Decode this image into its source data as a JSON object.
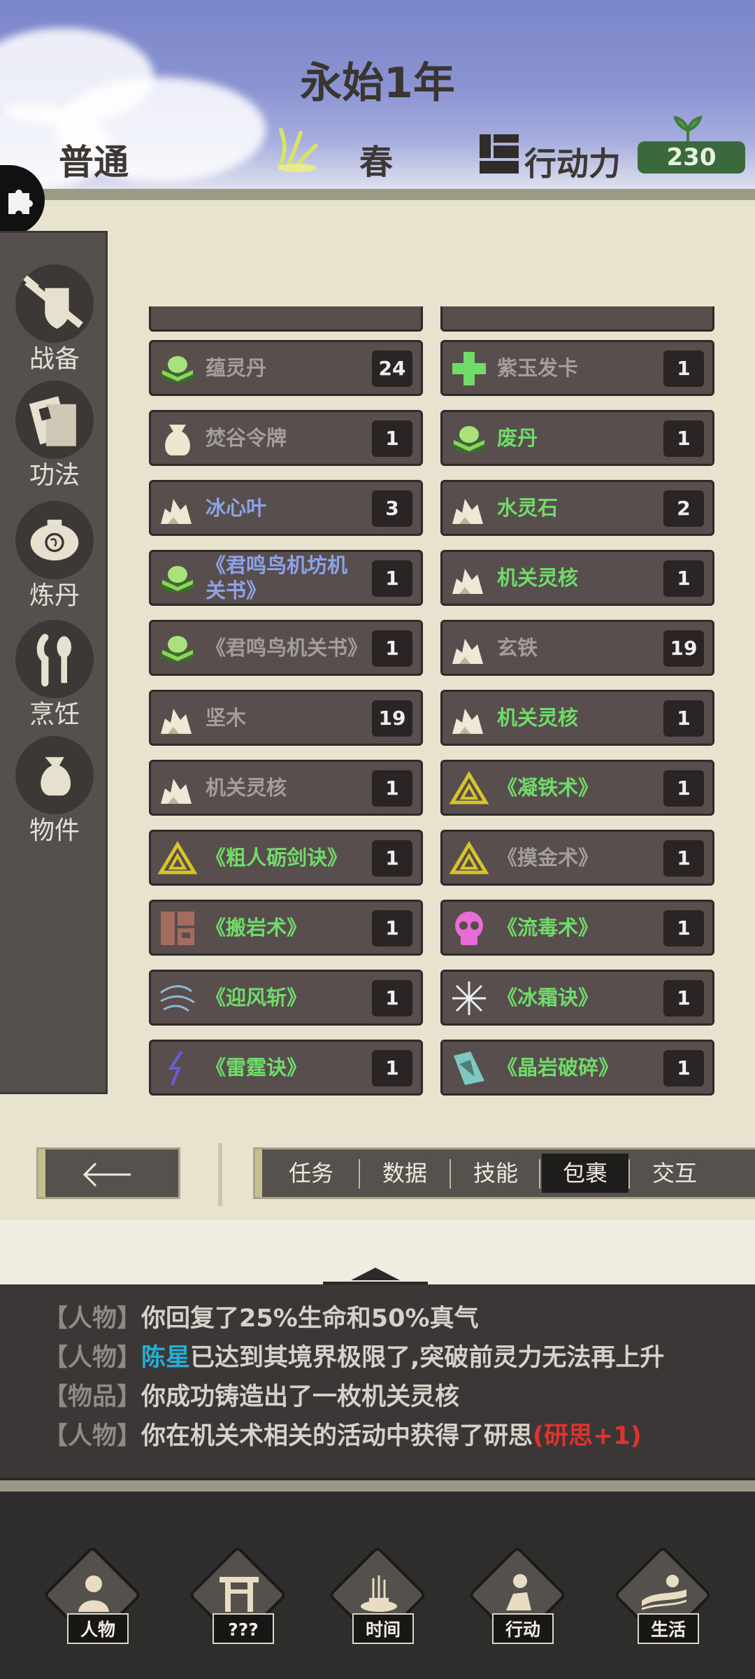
{
  "header": {
    "title": "永始1年",
    "difficulty": "普通",
    "season": "春",
    "action_label": "行动力",
    "action_value": "230"
  },
  "sidebar": {
    "items": [
      {
        "label": "战备",
        "icon": "sword-shield-icon"
      },
      {
        "label": "功法",
        "icon": "book-icon"
      },
      {
        "label": "炼丹",
        "icon": "cauldron-icon"
      },
      {
        "label": "烹饪",
        "icon": "fork-spoon-icon"
      },
      {
        "label": "物件",
        "icon": "bag-icon"
      }
    ]
  },
  "inventory": {
    "left": [
      {
        "name": "蕴灵丹",
        "count": "24",
        "color": "gray",
        "icon": "pill-icon"
      },
      {
        "name": "焚谷令牌",
        "count": "1",
        "color": "gray",
        "icon": "pouch-icon"
      },
      {
        "name": "冰心叶",
        "count": "3",
        "color": "blue",
        "icon": "ore-icon"
      },
      {
        "name": "《君鸣鸟机坊机关书》",
        "count": "1",
        "color": "blue",
        "icon": "pill-icon"
      },
      {
        "name": "《君鸣鸟机关书》",
        "count": "1",
        "color": "gray",
        "icon": "pill-icon"
      },
      {
        "name": "坚木",
        "count": "19",
        "color": "gray",
        "icon": "ore-icon"
      },
      {
        "name": "机关灵核",
        "count": "1",
        "color": "gray",
        "icon": "ore-icon"
      },
      {
        "name": "《粗人砺剑诀》",
        "count": "1",
        "color": "green",
        "icon": "triangle-icon"
      },
      {
        "name": "《搬岩术》",
        "count": "1",
        "color": "green",
        "icon": "block-icon"
      },
      {
        "name": "《迎风斩》",
        "count": "1",
        "color": "green",
        "icon": "wind-icon"
      },
      {
        "name": "《雷霆诀》",
        "count": "1",
        "color": "green",
        "icon": "lightning-icon"
      }
    ],
    "right": [
      {
        "name": "紫玉发卡",
        "count": "1",
        "color": "gray",
        "icon": "cross-icon"
      },
      {
        "name": "废丹",
        "count": "1",
        "color": "green",
        "icon": "pill-icon"
      },
      {
        "name": "水灵石",
        "count": "2",
        "color": "green",
        "icon": "ore-icon"
      },
      {
        "name": "机关灵核",
        "count": "1",
        "color": "green",
        "icon": "ore-icon"
      },
      {
        "name": "玄铁",
        "count": "19",
        "color": "gray",
        "icon": "ore-icon"
      },
      {
        "name": "机关灵核",
        "count": "1",
        "color": "green",
        "icon": "ore-icon"
      },
      {
        "name": "《凝铁术》",
        "count": "1",
        "color": "green",
        "icon": "triangle-icon"
      },
      {
        "name": "《摸金术》",
        "count": "1",
        "color": "gray",
        "icon": "triangle-icon"
      },
      {
        "name": "《流毒术》",
        "count": "1",
        "color": "green",
        "icon": "skull-icon"
      },
      {
        "name": "《冰霜诀》",
        "count": "1",
        "color": "green",
        "icon": "frost-icon"
      },
      {
        "name": "《晶岩破碎》",
        "count": "1",
        "color": "green",
        "icon": "crystal-icon"
      }
    ]
  },
  "tabs": {
    "items": [
      "任务",
      "数据",
      "技能",
      "包裹",
      "交互"
    ],
    "active": "包裹"
  },
  "log": {
    "lines": [
      {
        "tag": "【人物】",
        "name": "",
        "text": "你回复了25%生命和50%真气",
        "extra": ""
      },
      {
        "tag": "【人物】",
        "name": "陈星",
        "text": "已达到其境界极限了,突破前灵力无法再上升",
        "extra": ""
      },
      {
        "tag": "【物品】",
        "name": "",
        "text": "你成功铸造出了一枚机关灵核",
        "extra": ""
      },
      {
        "tag": "【人物】",
        "name": "",
        "text": "你在机关术相关的活动中获得了研思",
        "extra": "(研思+1)"
      }
    ]
  },
  "bottom_nav": {
    "items": [
      {
        "label": "人物",
        "icon": "person-icon"
      },
      {
        "label": "???",
        "icon": "gate-icon"
      },
      {
        "label": "时间",
        "icon": "incense-icon"
      },
      {
        "label": "行动",
        "icon": "action-icon"
      },
      {
        "label": "生活",
        "icon": "landscape-icon"
      }
    ]
  },
  "colors": {
    "gray": "#a29e9c",
    "blue": "#8da3e8",
    "green": "#6fdc6a",
    "accent_red": "#e3322e",
    "name_cyan": "#1fb2d6"
  }
}
